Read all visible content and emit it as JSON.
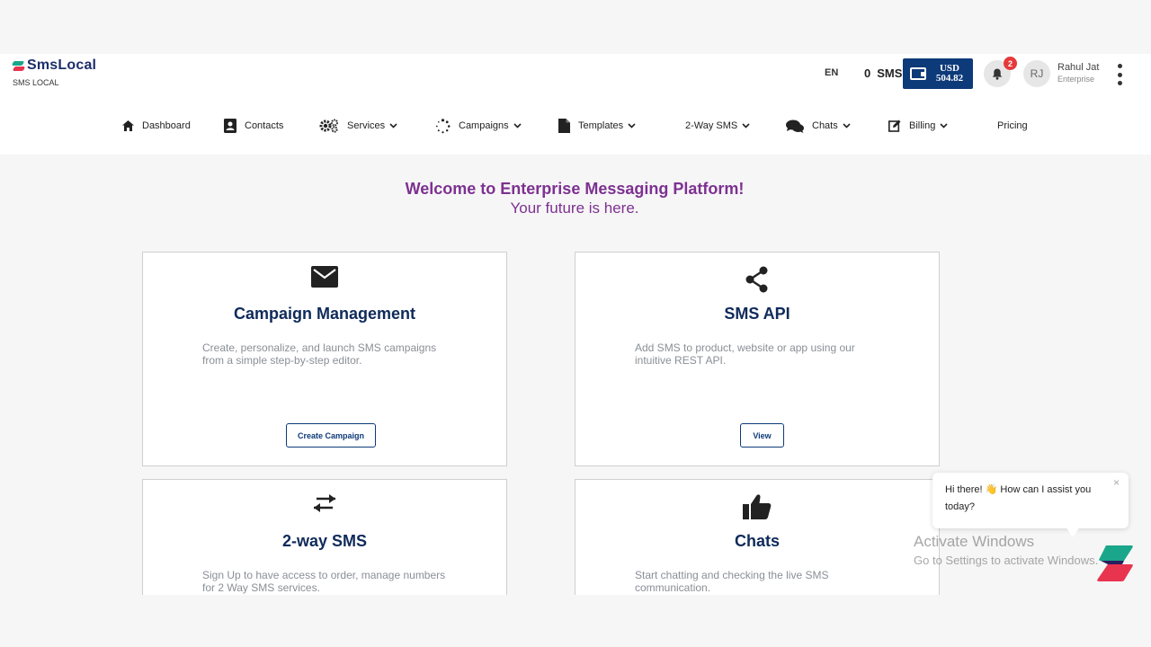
{
  "brand": {
    "name": "SmsLocal",
    "subtitle": "SMS LOCAL"
  },
  "header": {
    "language": "EN",
    "sms_count": "0",
    "sms_label": "SMS",
    "wallet_currency": "USD",
    "wallet_amount": "504.82",
    "notification_count": "2",
    "user_initials": "RJ",
    "user_name": "Rahul Jat",
    "user_role": "Enterprise"
  },
  "nav": {
    "dashboard": "Dashboard",
    "contacts": "Contacts",
    "services": "Services",
    "campaigns": "Campaigns",
    "templates": "Templates",
    "two_way_sms": "2-Way SMS",
    "chats": "Chats",
    "billing": "Billing",
    "pricing": "Pricing"
  },
  "welcome": {
    "title": "Welcome to Enterprise Messaging Platform!",
    "subtitle": "Your future is here."
  },
  "cards": [
    {
      "icon": "envelope-icon",
      "title": "Campaign Management",
      "description": "Create, personalize, and launch SMS campaigns from a simple step-by-step editor.",
      "button": "Create Campaign"
    },
    {
      "icon": "share-icon",
      "title": "SMS API",
      "description": "Add SMS to product, website or app using our intuitive REST API.",
      "button": "View"
    },
    {
      "icon": "exchange-arrows-icon",
      "title": "2-way SMS",
      "description": "Sign Up to have access to order, manage numbers for 2 Way SMS services."
    },
    {
      "icon": "thumbs-up-icon",
      "title": "Chats",
      "description": "Start chatting and checking the live SMS communication."
    }
  ],
  "chat_widget": {
    "greeting": "Hi there! 👋 How can I assist you today?",
    "close": "×"
  },
  "watermark": {
    "line1": "Activate Windows",
    "line2": "Go to Settings to activate Windows."
  },
  "colors": {
    "brand_navy": "#0d3a79",
    "heading_purple": "#7d3191",
    "card_title": "#0f2a5a",
    "badge_red": "#e63939"
  }
}
